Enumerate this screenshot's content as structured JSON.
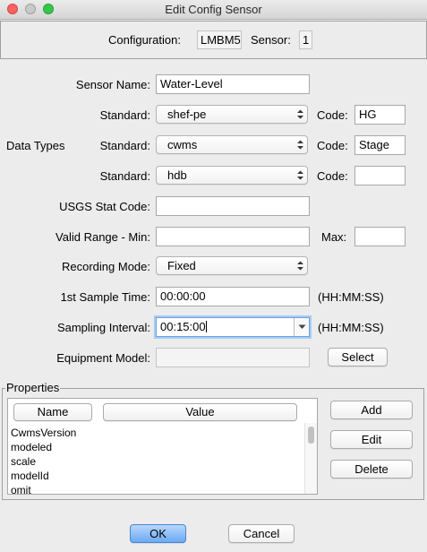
{
  "window": {
    "title": "Edit Config Sensor"
  },
  "header": {
    "configuration_label": "Configuration:",
    "configuration_value": "LMBM5",
    "sensor_label": "Sensor:",
    "sensor_value": "1"
  },
  "form": {
    "sensor_name_label": "Sensor Name:",
    "sensor_name_value": "Water-Level",
    "data_types_label": "Data Types",
    "standard_label": "Standard:",
    "code_label": "Code:",
    "data_types": [
      {
        "standard": "shef-pe",
        "code": "HG"
      },
      {
        "standard": "cwms",
        "code": "Stage"
      },
      {
        "standard": "hdb",
        "code": ""
      }
    ],
    "usgs_stat_code_label": "USGS Stat Code:",
    "usgs_stat_code_value": "",
    "valid_range_min_label": "Valid Range - Min:",
    "valid_range_min_value": "",
    "max_label": "Max:",
    "max_value": "",
    "recording_mode_label": "Recording Mode:",
    "recording_mode_value": "Fixed",
    "first_sample_time_label": "1st Sample Time:",
    "first_sample_time_value": "00:00:00",
    "sampling_interval_label": "Sampling Interval:",
    "sampling_interval_value": "00:15:00",
    "time_format_hint": "(HH:MM:SS)",
    "equipment_model_label": "Equipment Model:",
    "equipment_model_value": "",
    "select_button": "Select"
  },
  "properties": {
    "title": "Properties",
    "columns": [
      "Name",
      "Value"
    ],
    "items": [
      "CwmsVersion",
      "modeled",
      "scale",
      "modelId",
      "omit"
    ],
    "add_button": "Add",
    "edit_button": "Edit",
    "delete_button": "Delete"
  },
  "footer": {
    "ok_button": "OK",
    "cancel_button": "Cancel"
  },
  "colors": {
    "accent": "#6aa9f3",
    "window_bg": "#ececec"
  }
}
